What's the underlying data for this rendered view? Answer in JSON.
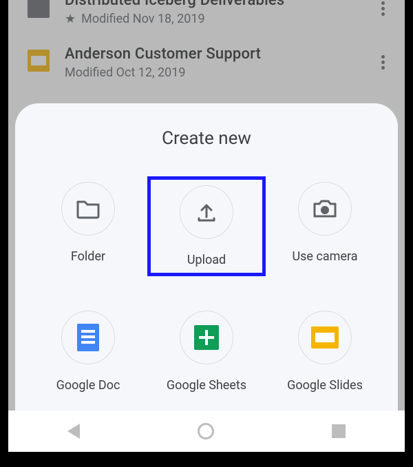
{
  "files": [
    {
      "title": "Distributed Iceberg Deliverables",
      "meta": "Modified Nov 18, 2019",
      "starred": true
    },
    {
      "title": "Anderson Customer Support",
      "meta": "Modified Oct 12, 2019",
      "starred": false
    }
  ],
  "sheet": {
    "title": "Create new",
    "options": [
      {
        "label": "Folder"
      },
      {
        "label": "Upload"
      },
      {
        "label": "Use camera"
      },
      {
        "label": "Google Doc"
      },
      {
        "label": "Google Sheets"
      },
      {
        "label": "Google Slides"
      }
    ]
  }
}
